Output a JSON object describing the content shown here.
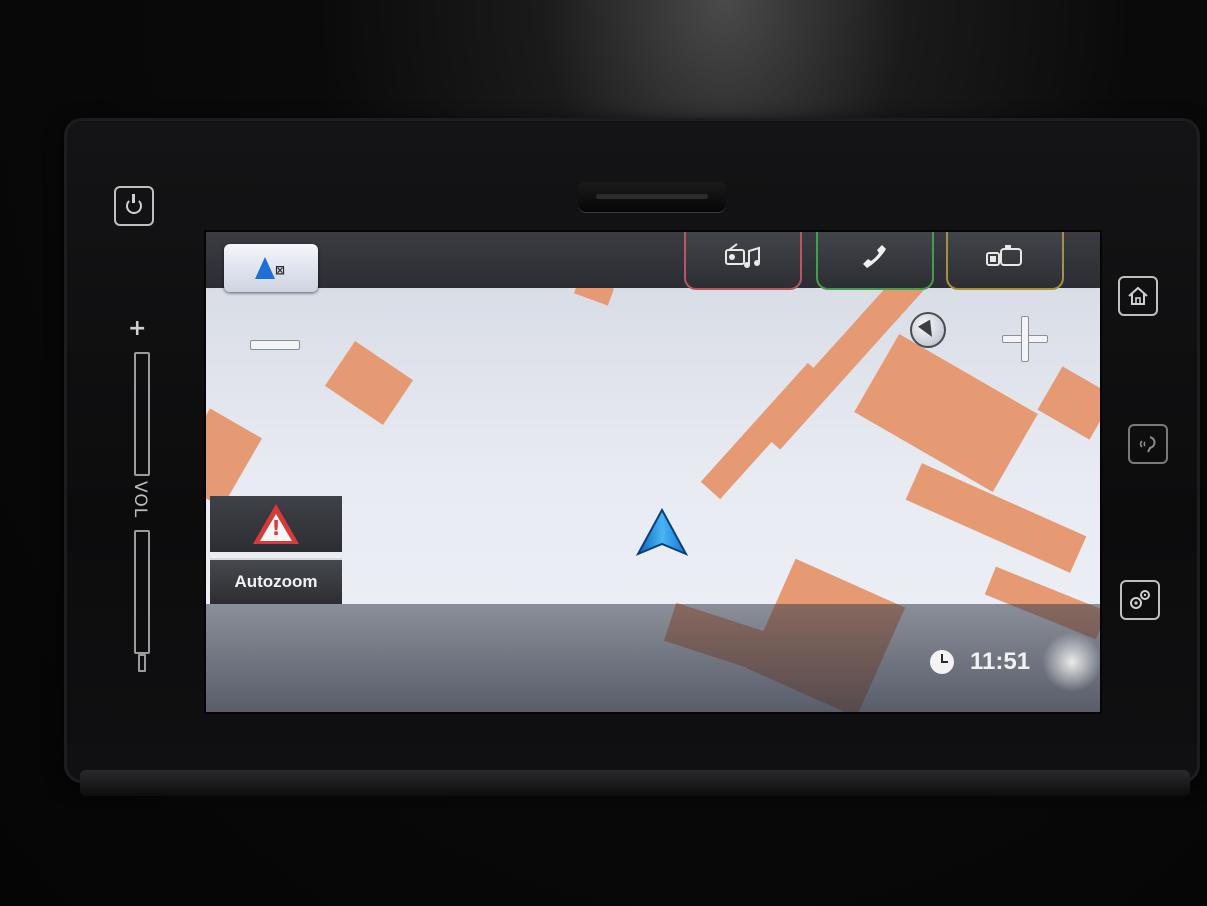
{
  "device": {
    "volume_label": "VOL"
  },
  "nav": {
    "autozoom_label": "Autozoom",
    "clock_time": "11:51"
  },
  "icons": {
    "power": "power-icon",
    "home": "home-icon",
    "voice": "voice-command-icon",
    "settings": "gear-icon",
    "map_mode": "map-view-mode-icon",
    "media": "media-audio-icon",
    "phone": "phone-handset-icon",
    "apps": "apps-icon",
    "compass": "compass-icon",
    "zoom_in": "zoom-in-icon",
    "zoom_out": "zoom-out-icon",
    "warning": "warning-triangle-icon",
    "vehicle": "vehicle-position-arrow-icon",
    "clock": "clock-icon"
  },
  "colors": {
    "map_background": "#e8ebf2",
    "building": "#e59a74",
    "vehicle_arrow": "#1e88e5",
    "media_tab_accent": "#b25a62",
    "phone_tab_accent": "#4a9a50",
    "apps_tab_accent": "#a8903e",
    "warning_red": "#d83a3a"
  }
}
